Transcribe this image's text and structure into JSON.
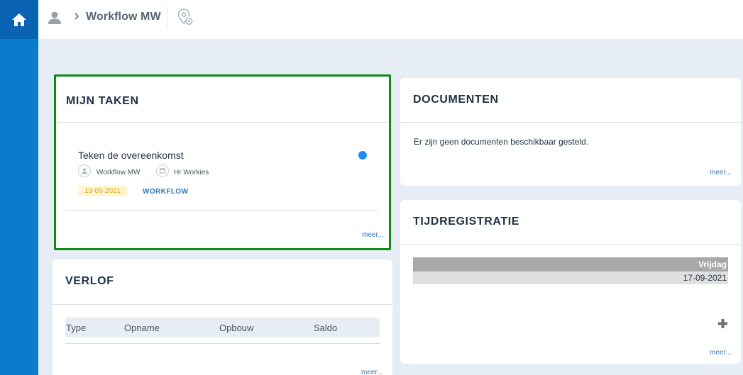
{
  "header": {
    "breadcrumb_title": "Workflow MW"
  },
  "icons": {
    "home": "home-icon",
    "user": "user-icon",
    "chevron": "chevron-right-icon",
    "location": "location-settings-icon"
  },
  "colors": {
    "sidebar": "#0a7cd0",
    "home_button": "#0963b2",
    "highlight_border": "#0f8a17",
    "link": "#2c78bf",
    "task_dot": "#1e8ff0",
    "date_badge_bg": "#fff5d1",
    "date_badge_text": "#e4a51a"
  },
  "mijn_taken": {
    "title": "MIJN TAKEN",
    "task": {
      "title": "Teken de overeenkomst",
      "assignee": "Workflow MW",
      "group": "Hr Workies",
      "date": "13-09-2021",
      "type": "WORKFLOW"
    },
    "more": "meer..."
  },
  "verlof": {
    "title": "VERLOF",
    "columns": [
      "Type",
      "Opname",
      "Opbouw",
      "Saldo"
    ],
    "more": "meer..."
  },
  "documenten": {
    "title": "DOCUMENTEN",
    "empty_message": "Er zijn geen documenten beschikbaar gesteld.",
    "more": "meer..."
  },
  "tijdregistratie": {
    "title": "TIJDREGISTRATIE",
    "day": "Vrijdag",
    "date": "17-09-2021",
    "more": "meer..."
  }
}
